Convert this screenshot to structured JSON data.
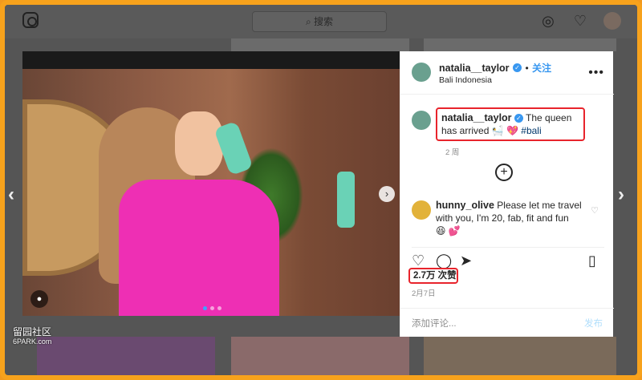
{
  "topbar": {
    "search_placeholder": "搜索",
    "icons": [
      "instagram-icon",
      "search-icon",
      "compass-icon",
      "heart-icon",
      "avatar"
    ]
  },
  "post": {
    "author": {
      "username": "natalia__taylor",
      "follow_label": "关注",
      "location": "Bali Indonesia"
    },
    "caption": {
      "username": "natalia__taylor",
      "text": "The queen has arrived",
      "emoji": "🛀 💖",
      "hashtag": "#bali",
      "time": "2 周"
    },
    "comments": [
      {
        "username": "hunny_olive",
        "text": "Please let me travel with you, I'm 20, fab, fit and fun",
        "emoji": "😆 💕"
      }
    ],
    "likes_label": "2.7万 次赞",
    "date": "2月7日",
    "comment_placeholder": "添加评论...",
    "post_label": "发布",
    "more_label": "•••"
  },
  "watermark": {
    "line1": "留园社区",
    "line2": "6PARK.com"
  },
  "colors": {
    "frame": "#f7a21c",
    "highlight": "#e8242c",
    "link": "#3897f0"
  }
}
